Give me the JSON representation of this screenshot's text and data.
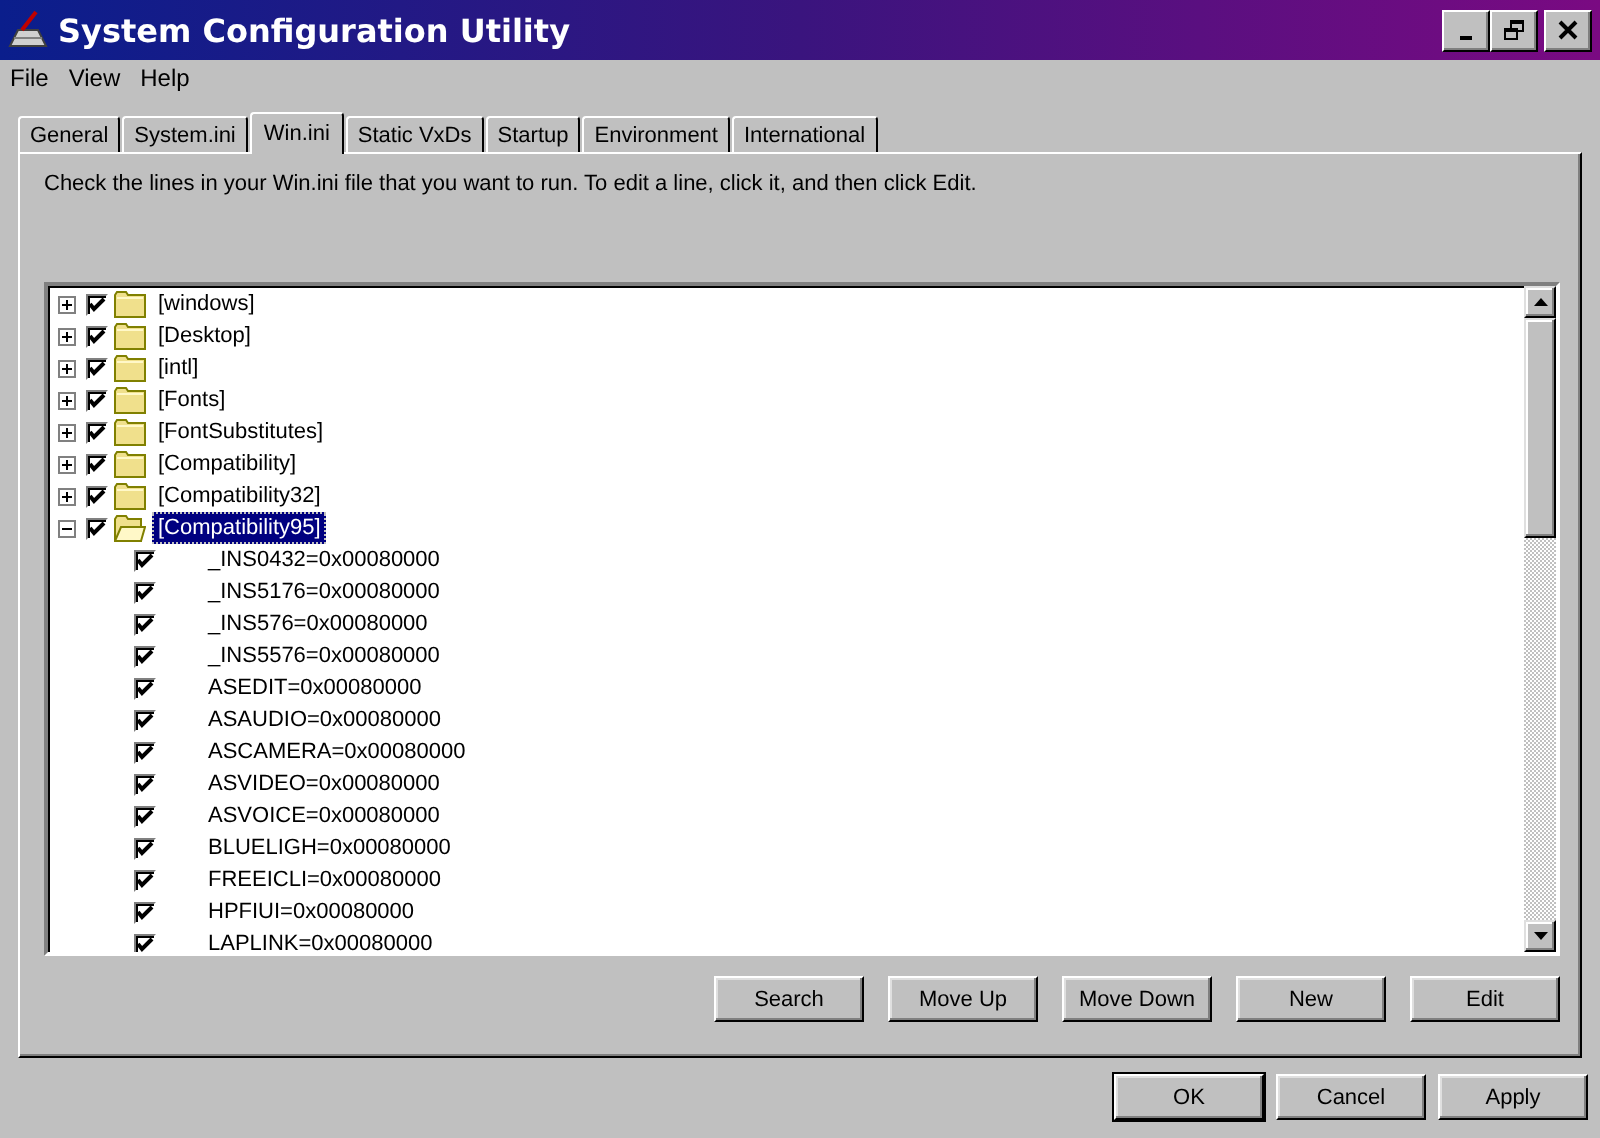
{
  "window": {
    "title": "System Configuration Utility"
  },
  "menu": [
    {
      "label": "File"
    },
    {
      "label": "View"
    },
    {
      "label": "Help"
    }
  ],
  "tabs": [
    {
      "label": "General",
      "selected": false
    },
    {
      "label": "System.ini",
      "selected": false
    },
    {
      "label": "Win.ini",
      "selected": true
    },
    {
      "label": "Static VxDs",
      "selected": false
    },
    {
      "label": "Startup",
      "selected": false
    },
    {
      "label": "Environment",
      "selected": false
    },
    {
      "label": "International",
      "selected": false
    }
  ],
  "description": "Check the lines in your Win.ini file that you want to run. To edit a line, click it, and then click Edit.",
  "tree": [
    {
      "label": "[windows]",
      "expanded": false,
      "checked": true,
      "selected": false
    },
    {
      "label": "[Desktop]",
      "expanded": false,
      "checked": true,
      "selected": false
    },
    {
      "label": "[intl]",
      "expanded": false,
      "checked": true,
      "selected": false
    },
    {
      "label": "[Fonts]",
      "expanded": false,
      "checked": true,
      "selected": false
    },
    {
      "label": "[FontSubstitutes]",
      "expanded": false,
      "checked": true,
      "selected": false
    },
    {
      "label": "[Compatibility]",
      "expanded": false,
      "checked": true,
      "selected": false
    },
    {
      "label": "[Compatibility32]",
      "expanded": false,
      "checked": true,
      "selected": false
    },
    {
      "label": "[Compatibility95]",
      "expanded": true,
      "checked": true,
      "selected": true,
      "children": [
        {
          "label": "_INS0432=0x00080000",
          "checked": true
        },
        {
          "label": "_INS5176=0x00080000",
          "checked": true
        },
        {
          "label": "_INS576=0x00080000",
          "checked": true
        },
        {
          "label": "_INS5576=0x00080000",
          "checked": true
        },
        {
          "label": "ASEDIT=0x00080000",
          "checked": true
        },
        {
          "label": "ASAUDIO=0x00080000",
          "checked": true
        },
        {
          "label": "ASCAMERA=0x00080000",
          "checked": true
        },
        {
          "label": "ASVIDEO=0x00080000",
          "checked": true
        },
        {
          "label": "ASVOICE=0x00080000",
          "checked": true
        },
        {
          "label": "BLUELIGH=0x00080000",
          "checked": true
        },
        {
          "label": "FREEICLI=0x00080000",
          "checked": true
        },
        {
          "label": "HPFIUI=0x00080000",
          "checked": true
        },
        {
          "label": "LAPLINK=0x00080000",
          "checked": true
        }
      ]
    }
  ],
  "action_buttons": [
    {
      "label": "Search"
    },
    {
      "label": "Move Up"
    },
    {
      "label": "Move Down"
    },
    {
      "label": "New"
    },
    {
      "label": "Edit"
    }
  ],
  "dialog_buttons": [
    {
      "label": "OK",
      "default": true
    },
    {
      "label": "Cancel",
      "default": false
    },
    {
      "label": "Apply",
      "default": false
    }
  ]
}
